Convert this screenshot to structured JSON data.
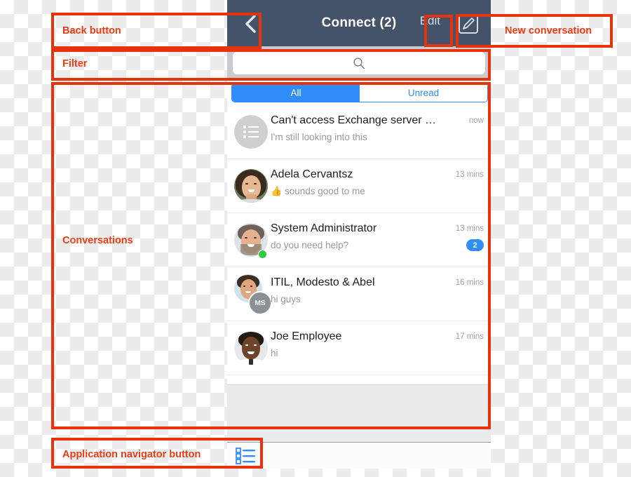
{
  "app": {
    "navbar": {
      "title": "Connect (2)",
      "back_icon": "chevron-left-icon",
      "edit_label": "Edit",
      "compose_icon": "compose-pencil-icon",
      "bg_color": "#44536a"
    },
    "search": {
      "placeholder": "",
      "value": "",
      "icon": "search-icon"
    },
    "filter_tabs": [
      {
        "label": "All",
        "selected": true
      },
      {
        "label": "Unread",
        "selected": false
      }
    ],
    "accent_color": "#2f8cf8",
    "conversations": [
      {
        "title": "Can't access Exchange server -...",
        "snippet": "I'm still looking into this",
        "time": "now",
        "avatar": "list-icon-avatar",
        "badge": "",
        "online": false,
        "emoji": ""
      },
      {
        "title": "Adela Cervantsz",
        "snippet": "sounds good to me",
        "time": "13 mins",
        "avatar": "photo-avatar-woman",
        "badge": "",
        "online": false,
        "emoji": "👍"
      },
      {
        "title": "System Administrator",
        "snippet": "do you need help?",
        "time": "13 mins",
        "avatar": "photo-avatar-man-beard",
        "badge": "2",
        "online": true,
        "emoji": ""
      },
      {
        "title": "ITIL, Modesto & Abel",
        "snippet": "hi guys",
        "time": "16 mins",
        "avatar": "group-avatar",
        "group_initials": "MS",
        "badge": "",
        "online": false,
        "emoji": ""
      },
      {
        "title": "Joe Employee",
        "snippet": "hi",
        "time": "17 mins",
        "avatar": "photo-avatar-man-suit",
        "badge": "",
        "online": false,
        "emoji": ""
      }
    ],
    "toolbar": {
      "app_navigator_icon": "application-navigator-icon"
    }
  },
  "annotations": {
    "color": "#ee3b11",
    "items": [
      {
        "label": "Back button"
      },
      {
        "label": "Filter"
      },
      {
        "label": "Conversations"
      },
      {
        "label": "New conversation"
      },
      {
        "label": "Edit"
      },
      {
        "label": "Application navigator button"
      }
    ]
  }
}
